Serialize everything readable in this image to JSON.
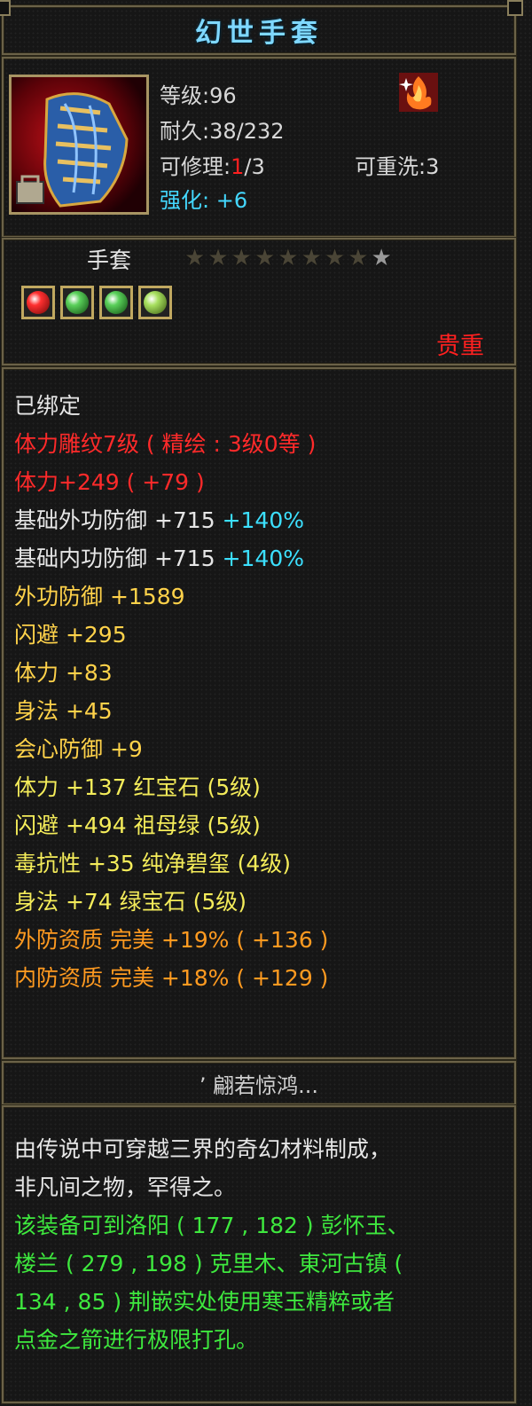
{
  "item": {
    "name": "幻世手套",
    "level_label": "等级:96",
    "durability_label": "耐久:38/232",
    "repair_prefix": "可修理:",
    "repair_current": "1",
    "repair_suffix": "/3",
    "rewash_label": "可重洗:3",
    "enhance_label": "强化: +6",
    "type": "手套",
    "stars_filled": 8,
    "stars_total": 9,
    "rarity": "贵重",
    "gems": [
      "red-gem-icon",
      "green-gem-icon",
      "green-gem-icon",
      "jade-gem-icon"
    ]
  },
  "stats": [
    {
      "text": "已绑定",
      "color": "white"
    },
    {
      "text": "体力雕纹7级 ( 精绘 : 3级0等 )",
      "color": "red"
    },
    {
      "text": "体力+249 ( +79 )",
      "color": "red"
    },
    {
      "text": "基础外功防御 +715",
      "extra": " +140%",
      "color": "white"
    },
    {
      "text": "基础内功防御 +715",
      "extra": " +140%",
      "color": "white"
    },
    {
      "text": "外功防御 +1589",
      "color": "gold"
    },
    {
      "text": "闪避 +295",
      "color": "gold"
    },
    {
      "text": "体力 +83",
      "color": "gold"
    },
    {
      "text": "身法 +45",
      "color": "gold"
    },
    {
      "text": "会心防御 +9",
      "color": "gold"
    },
    {
      "text": "体力 +137 红宝石 (5级)",
      "color": "yellow"
    },
    {
      "text": "闪避 +494 祖母绿 (5级)",
      "color": "yellow"
    },
    {
      "text": "毒抗性 +35 纯净碧玺 (4级)",
      "color": "yellow"
    },
    {
      "text": "身法 +74 绿宝石 (5级)",
      "color": "yellow"
    },
    {
      "text": "外防资质  完美 +19% ( +136 )",
      "color": "orange"
    },
    {
      "text": "内防资质  完美 +18% ( +129 )",
      "color": "orange"
    }
  ],
  "set_name": "’ 翩若惊鸿...",
  "description": [
    {
      "text": "由传说中可穿越三界的奇幻材料制成，",
      "color": "white"
    },
    {
      "text": "非凡间之物，罕得之。",
      "color": "white"
    },
    {
      "text": "该装备可到洛阳 ( 177 , 182 ) 彭怀玉、",
      "color": "green"
    },
    {
      "text": "楼兰 ( 279 , 198 ) 克里木、東河古镇 (",
      "color": "green"
    },
    {
      "text": "134 , 85 ) 荆嵌实处使用寒玉精粹或者",
      "color": "green"
    },
    {
      "text": "点金之箭进行极限打孔。",
      "color": "green"
    }
  ]
}
